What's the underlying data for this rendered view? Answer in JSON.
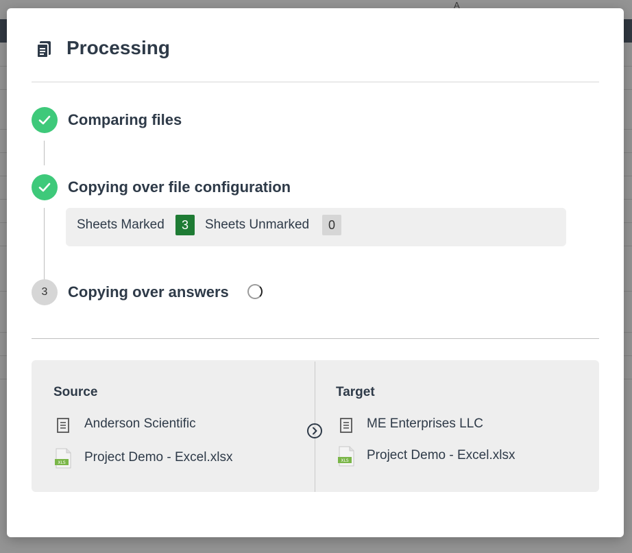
{
  "modal": {
    "title": "Processing",
    "title_icon": "documents-icon"
  },
  "steps": [
    {
      "label": "Comparing files",
      "status": "done"
    },
    {
      "label": "Copying over file configuration",
      "status": "done"
    },
    {
      "label": "Copying over answers",
      "status": "in-progress",
      "number": "3"
    }
  ],
  "sheets": {
    "marked_label": "Sheets Marked",
    "marked_count": "3",
    "unmarked_label": "Sheets Unmarked",
    "unmarked_count": "0"
  },
  "source": {
    "heading": "Source",
    "company": "Anderson Scientific",
    "file": "Project Demo - Excel.xlsx"
  },
  "target": {
    "heading": "Target",
    "company": "ME Enterprises LLC",
    "file": "Project Demo - Excel.xlsx"
  },
  "colors": {
    "done": "#3ec97a",
    "marked_badge": "#1e7b34",
    "unmarked_badge": "#d6d6d6",
    "text": "#2e3a48"
  }
}
